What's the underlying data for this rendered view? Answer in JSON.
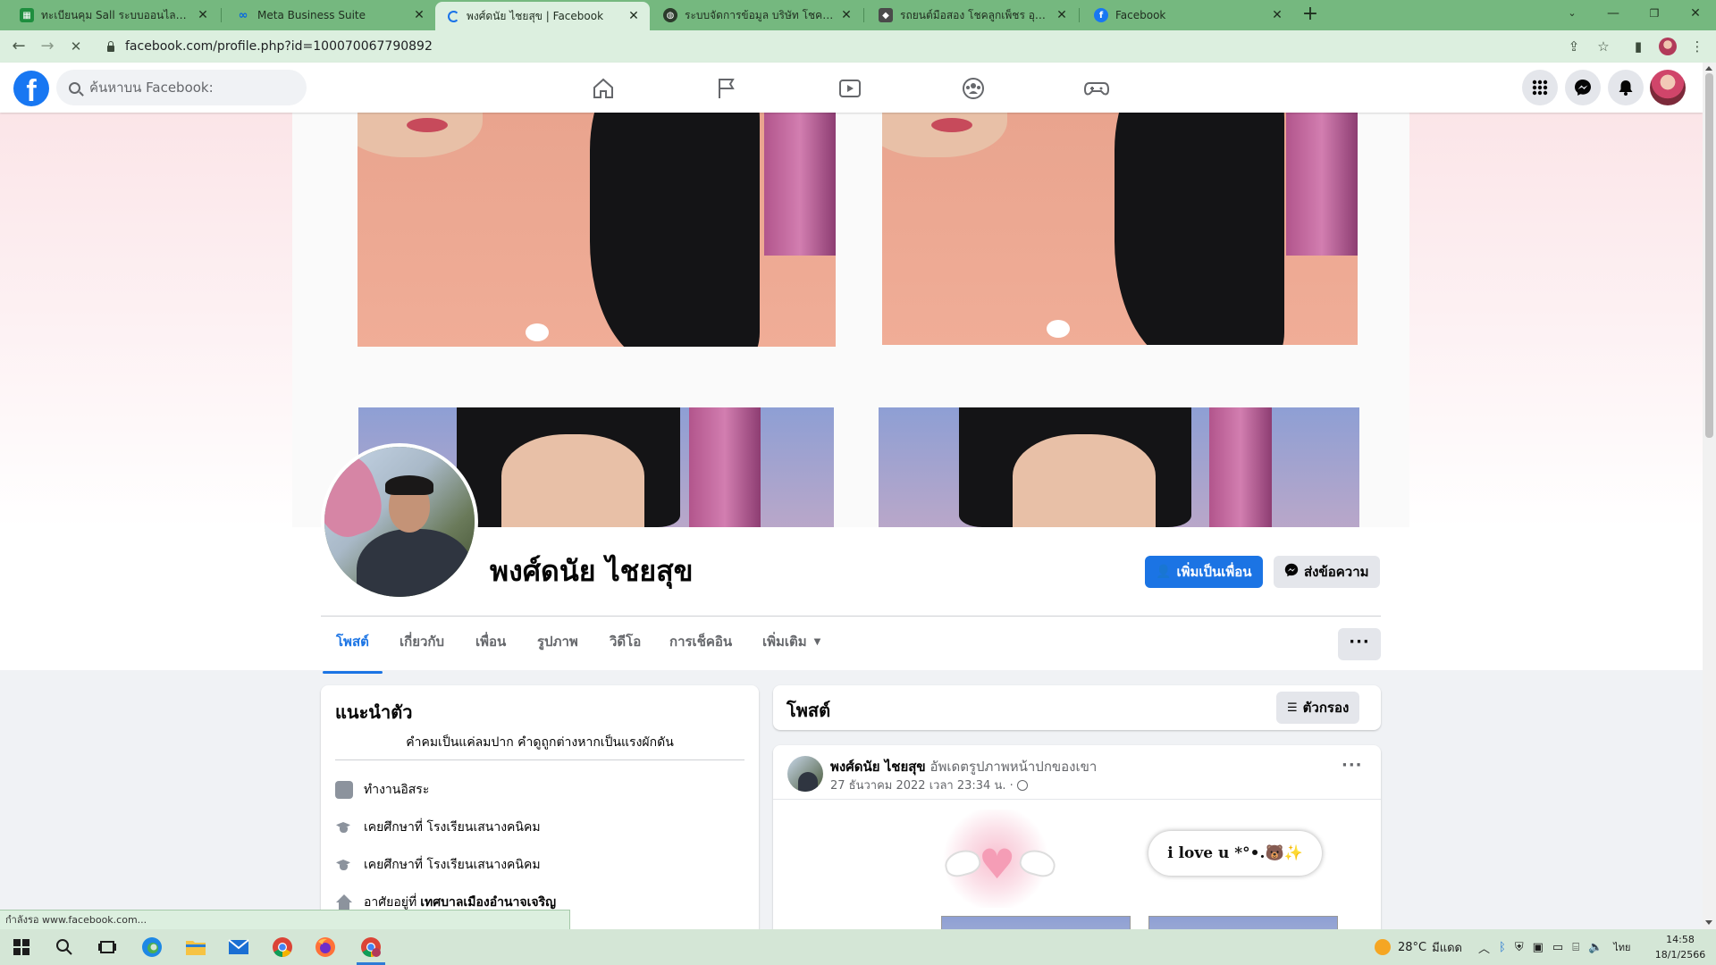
{
  "browser": {
    "tabs": [
      {
        "title": "ทะเบียนคุม Sall ระบบออนไลน์.xlsx - G",
        "icon": "sheets-icon"
      },
      {
        "title": "Meta Business Suite",
        "icon": "meta-icon"
      },
      {
        "title": "พงศ์ดนัย ไชยสุข | Facebook",
        "icon": "loading-icon"
      },
      {
        "title": "ระบบจัดการข้อมูล บริษัท โชคลูกเพ็ชร",
        "icon": "globe-icon"
      },
      {
        "title": "รถยนต์มือสอง โชคลูกเพ็ชร อุดรธานี",
        "icon": "site-icon"
      },
      {
        "title": "Facebook",
        "icon": "facebook-icon"
      }
    ],
    "url": "facebook.com/profile.php?id=100070067790892",
    "status_text": "กำลังรอ www.facebook.com..."
  },
  "facebook": {
    "search_placeholder": "ค้นหาบน Facebook:",
    "profile_name": "พงศ์ดนัย ไชยสุข",
    "add_friend_label": "เพิ่มเป็นเพื่อน",
    "message_label": "ส่งข้อความ",
    "profile_tabs": [
      "โพสต์",
      "เกี่ยวกับ",
      "เพื่อน",
      "รูปภาพ",
      "วิดีโอ",
      "การเช็คอิน",
      "เพิ่มเติม"
    ],
    "intro": {
      "title": "แนะนำตัว",
      "bio": "คำคมเป็นแค่ลมปาก คำดูถูกต่างหากเป็นแรงผักดัน",
      "rows": [
        {
          "icon": "briefcase-icon",
          "text": "ทำงานอิสระ",
          "bold": ""
        },
        {
          "icon": "graduation-cap-icon",
          "text": "เคยศึกษาที่ โรงเรียนเสนางคนิคม",
          "bold": ""
        },
        {
          "icon": "graduation-cap-icon",
          "text": "เคยศึกษาที่ โรงเรียนเสนางคนิคม",
          "bold": ""
        },
        {
          "icon": "home-icon",
          "text": "อาศัยอยู่ที่",
          "bold": "เทศบาลเมืองอำนาจเจริญ"
        }
      ]
    },
    "posts": {
      "title": "โพสต์",
      "filter_label": "ตัวกรอง",
      "post": {
        "author": "พงศ์ดนัย ไชยสุข",
        "action": "อัพเดตรูปภาพหน้าปกของเขา",
        "timestamp": "27 ธันวาคม 2022 เวลา 23:34 น. ·",
        "image_text": "i love u *°•.🐻✨"
      }
    }
  },
  "taskbar": {
    "temperature": "28°C",
    "weather": "มีแดด",
    "language": "ไทย",
    "time": "14:58",
    "date": "18/1/2566"
  },
  "colors": {
    "tabstrip": "#75b87f",
    "toolbar": "#dcefdf",
    "facebook_blue": "#1b74e4"
  }
}
